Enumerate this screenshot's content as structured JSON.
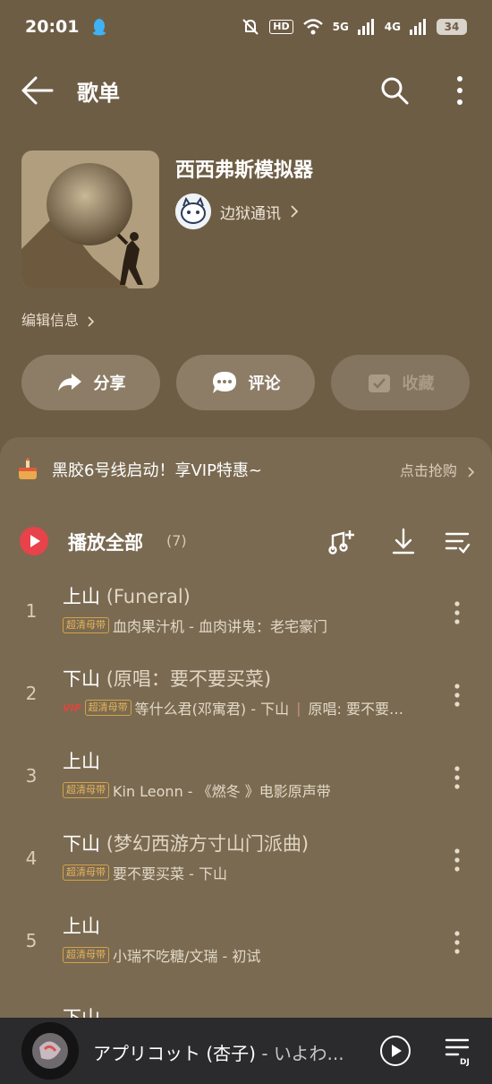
{
  "status": {
    "time": "20:01",
    "hd": "HD",
    "net1": "5G",
    "net2": "4G",
    "battery": "34"
  },
  "header": {
    "title": "歌单"
  },
  "playlist": {
    "name": "西西弗斯模拟器",
    "creator": "边狱通讯",
    "edit_info": "编辑信息",
    "actions": {
      "share": "分享",
      "comment": "评论",
      "collect": "收藏"
    }
  },
  "promo": {
    "text": "黑胶6号线启动！享VIP特惠~",
    "action": "点击抢购"
  },
  "list_header": {
    "label": "播放全部",
    "count": "(7)"
  },
  "songs": [
    {
      "num": "1",
      "title": "上山",
      "subtitle": "(Funeral)",
      "vip": "",
      "badge": "超清母带",
      "meta": "血肉果汁机 - 血肉讲鬼：老宅豪门",
      "meta2": ""
    },
    {
      "num": "2",
      "title": "下山",
      "subtitle": "(原唱：要不要买菜)",
      "vip": "VIP",
      "badge": "超清母带",
      "meta": "等什么君(邓寓君) - 下山",
      "meta2": "原唱: 要不要…"
    },
    {
      "num": "3",
      "title": "上山",
      "subtitle": "",
      "vip": "",
      "badge": "超清母带",
      "meta": "Kin Leonn - 《燃冬 》电影原声带",
      "meta2": ""
    },
    {
      "num": "4",
      "title": "下山",
      "subtitle": "(梦幻西游方寸山门派曲)",
      "vip": "",
      "badge": "超清母带",
      "meta": "要不要买菜 - 下山",
      "meta2": ""
    },
    {
      "num": "5",
      "title": "上山",
      "subtitle": "",
      "vip": "",
      "badge": "超清母带",
      "meta": "小瑞不吃糖/文瑞 - 初试",
      "meta2": ""
    }
  ],
  "partial_row": {
    "title": "下山"
  },
  "now_playing": {
    "title": "アプリコット (杏子)",
    "artist": " - いよわ..."
  },
  "colors": {
    "background": "#6e5d45",
    "sheet": "#7a6a51",
    "accent_red": "#e8424a",
    "badge_gold": "#e5b35a",
    "player_bg": "#2b2a2c"
  }
}
